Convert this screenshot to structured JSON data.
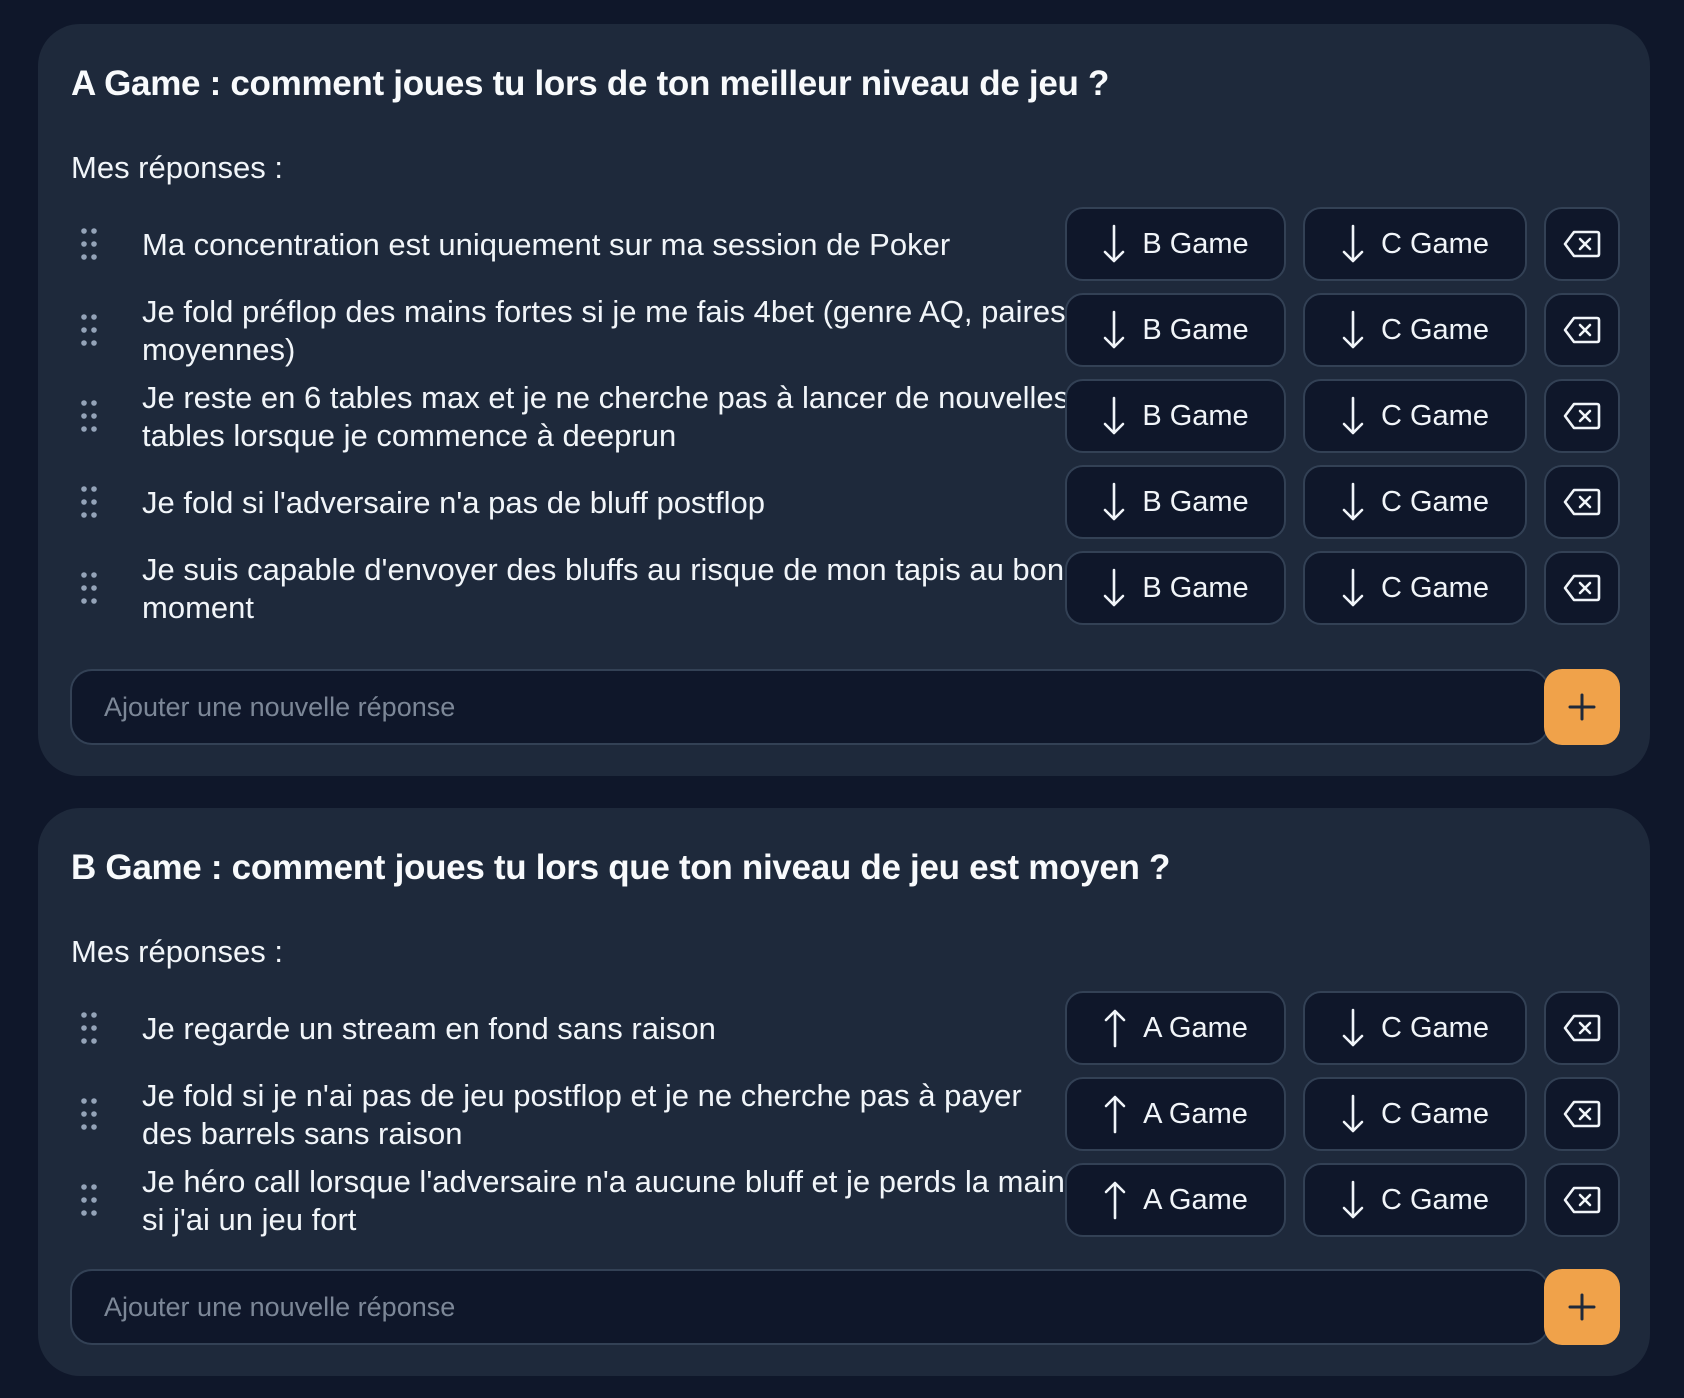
{
  "colors": {
    "page_background": "#0f172a",
    "card_background": "#1e293b",
    "button_background": "#0f172a",
    "button_border": "#334155",
    "text": "#f1f5f9",
    "placeholder": "#7c8797",
    "accent_add_button": "#f0a24a"
  },
  "sections": [
    {
      "title": "A Game : comment joues tu lors de ton meilleur niveau de jeu ?",
      "answers_label": "Mes réponses :",
      "answers": [
        {
          "text": "Ma concentration est uniquement sur ma session de Poker",
          "actions": [
            {
              "label": "B Game",
              "icon": "arrow-down-icon"
            },
            {
              "label": "C Game",
              "icon": "arrow-down-icon"
            }
          ],
          "delete_icon": "backspace-icon"
        },
        {
          "text": "Je fold préflop des mains fortes si je me fais 4bet (genre AQ, paires moyennes)",
          "actions": [
            {
              "label": "B Game",
              "icon": "arrow-down-icon"
            },
            {
              "label": "C Game",
              "icon": "arrow-down-icon"
            }
          ],
          "delete_icon": "backspace-icon"
        },
        {
          "text": "Je reste en 6 tables max et je ne cherche pas à lancer de nouvelles tables lorsque je commence à deeprun",
          "actions": [
            {
              "label": "B Game",
              "icon": "arrow-down-icon"
            },
            {
              "label": "C Game",
              "icon": "arrow-down-icon"
            }
          ],
          "delete_icon": "backspace-icon"
        },
        {
          "text": "Je fold si l'adversaire n'a pas de bluff postflop",
          "actions": [
            {
              "label": "B Game",
              "icon": "arrow-down-icon"
            },
            {
              "label": "C Game",
              "icon": "arrow-down-icon"
            }
          ],
          "delete_icon": "backspace-icon"
        },
        {
          "text": "Je suis capable d'envoyer des bluffs au risque de mon tapis au bon moment",
          "actions": [
            {
              "label": "B Game",
              "icon": "arrow-down-icon"
            },
            {
              "label": "C Game",
              "icon": "arrow-down-icon"
            }
          ],
          "delete_icon": "backspace-icon"
        }
      ],
      "input": {
        "placeholder": "Ajouter une nouvelle réponse",
        "value": ""
      },
      "add_button_icon": "plus-icon"
    },
    {
      "title": "B Game : comment joues tu lors que ton niveau de jeu est moyen ?",
      "answers_label": "Mes réponses :",
      "answers": [
        {
          "text": "Je regarde un stream en fond sans raison",
          "actions": [
            {
              "label": "A Game",
              "icon": "arrow-up-icon"
            },
            {
              "label": "C Game",
              "icon": "arrow-down-icon"
            }
          ],
          "delete_icon": "backspace-icon"
        },
        {
          "text": "Je fold si je n'ai pas de jeu postflop et je ne cherche pas à payer des barrels sans raison",
          "actions": [
            {
              "label": "A Game",
              "icon": "arrow-up-icon"
            },
            {
              "label": "C Game",
              "icon": "arrow-down-icon"
            }
          ],
          "delete_icon": "backspace-icon"
        },
        {
          "text": "Je héro call lorsque l'adversaire n'a aucune bluff et je perds la main si j'ai un jeu fort",
          "actions": [
            {
              "label": "A Game",
              "icon": "arrow-up-icon"
            },
            {
              "label": "C Game",
              "icon": "arrow-down-icon"
            }
          ],
          "delete_icon": "backspace-icon"
        }
      ],
      "input": {
        "placeholder": "Ajouter une nouvelle réponse",
        "value": ""
      },
      "add_button_icon": "plus-icon"
    }
  ]
}
